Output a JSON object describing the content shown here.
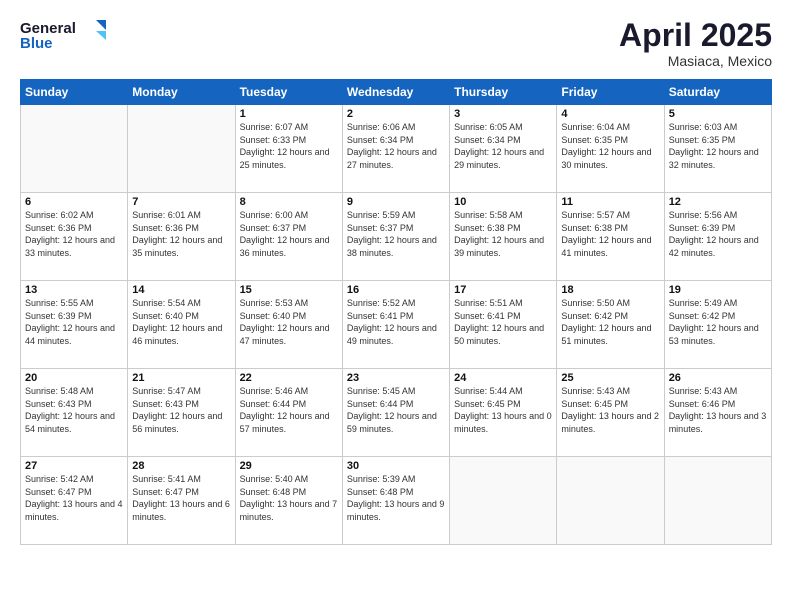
{
  "header": {
    "logo_line1": "General",
    "logo_line2": "Blue",
    "month": "April 2025",
    "location": "Masiaca, Mexico"
  },
  "days_of_week": [
    "Sunday",
    "Monday",
    "Tuesday",
    "Wednesday",
    "Thursday",
    "Friday",
    "Saturday"
  ],
  "weeks": [
    [
      {
        "day": "",
        "sunrise": "",
        "sunset": "",
        "daylight": ""
      },
      {
        "day": "",
        "sunrise": "",
        "sunset": "",
        "daylight": ""
      },
      {
        "day": "1",
        "sunrise": "Sunrise: 6:07 AM",
        "sunset": "Sunset: 6:33 PM",
        "daylight": "Daylight: 12 hours and 25 minutes."
      },
      {
        "day": "2",
        "sunrise": "Sunrise: 6:06 AM",
        "sunset": "Sunset: 6:34 PM",
        "daylight": "Daylight: 12 hours and 27 minutes."
      },
      {
        "day": "3",
        "sunrise": "Sunrise: 6:05 AM",
        "sunset": "Sunset: 6:34 PM",
        "daylight": "Daylight: 12 hours and 29 minutes."
      },
      {
        "day": "4",
        "sunrise": "Sunrise: 6:04 AM",
        "sunset": "Sunset: 6:35 PM",
        "daylight": "Daylight: 12 hours and 30 minutes."
      },
      {
        "day": "5",
        "sunrise": "Sunrise: 6:03 AM",
        "sunset": "Sunset: 6:35 PM",
        "daylight": "Daylight: 12 hours and 32 minutes."
      }
    ],
    [
      {
        "day": "6",
        "sunrise": "Sunrise: 6:02 AM",
        "sunset": "Sunset: 6:36 PM",
        "daylight": "Daylight: 12 hours and 33 minutes."
      },
      {
        "day": "7",
        "sunrise": "Sunrise: 6:01 AM",
        "sunset": "Sunset: 6:36 PM",
        "daylight": "Daylight: 12 hours and 35 minutes."
      },
      {
        "day": "8",
        "sunrise": "Sunrise: 6:00 AM",
        "sunset": "Sunset: 6:37 PM",
        "daylight": "Daylight: 12 hours and 36 minutes."
      },
      {
        "day": "9",
        "sunrise": "Sunrise: 5:59 AM",
        "sunset": "Sunset: 6:37 PM",
        "daylight": "Daylight: 12 hours and 38 minutes."
      },
      {
        "day": "10",
        "sunrise": "Sunrise: 5:58 AM",
        "sunset": "Sunset: 6:38 PM",
        "daylight": "Daylight: 12 hours and 39 minutes."
      },
      {
        "day": "11",
        "sunrise": "Sunrise: 5:57 AM",
        "sunset": "Sunset: 6:38 PM",
        "daylight": "Daylight: 12 hours and 41 minutes."
      },
      {
        "day": "12",
        "sunrise": "Sunrise: 5:56 AM",
        "sunset": "Sunset: 6:39 PM",
        "daylight": "Daylight: 12 hours and 42 minutes."
      }
    ],
    [
      {
        "day": "13",
        "sunrise": "Sunrise: 5:55 AM",
        "sunset": "Sunset: 6:39 PM",
        "daylight": "Daylight: 12 hours and 44 minutes."
      },
      {
        "day": "14",
        "sunrise": "Sunrise: 5:54 AM",
        "sunset": "Sunset: 6:40 PM",
        "daylight": "Daylight: 12 hours and 46 minutes."
      },
      {
        "day": "15",
        "sunrise": "Sunrise: 5:53 AM",
        "sunset": "Sunset: 6:40 PM",
        "daylight": "Daylight: 12 hours and 47 minutes."
      },
      {
        "day": "16",
        "sunrise": "Sunrise: 5:52 AM",
        "sunset": "Sunset: 6:41 PM",
        "daylight": "Daylight: 12 hours and 49 minutes."
      },
      {
        "day": "17",
        "sunrise": "Sunrise: 5:51 AM",
        "sunset": "Sunset: 6:41 PM",
        "daylight": "Daylight: 12 hours and 50 minutes."
      },
      {
        "day": "18",
        "sunrise": "Sunrise: 5:50 AM",
        "sunset": "Sunset: 6:42 PM",
        "daylight": "Daylight: 12 hours and 51 minutes."
      },
      {
        "day": "19",
        "sunrise": "Sunrise: 5:49 AM",
        "sunset": "Sunset: 6:42 PM",
        "daylight": "Daylight: 12 hours and 53 minutes."
      }
    ],
    [
      {
        "day": "20",
        "sunrise": "Sunrise: 5:48 AM",
        "sunset": "Sunset: 6:43 PM",
        "daylight": "Daylight: 12 hours and 54 minutes."
      },
      {
        "day": "21",
        "sunrise": "Sunrise: 5:47 AM",
        "sunset": "Sunset: 6:43 PM",
        "daylight": "Daylight: 12 hours and 56 minutes."
      },
      {
        "day": "22",
        "sunrise": "Sunrise: 5:46 AM",
        "sunset": "Sunset: 6:44 PM",
        "daylight": "Daylight: 12 hours and 57 minutes."
      },
      {
        "day": "23",
        "sunrise": "Sunrise: 5:45 AM",
        "sunset": "Sunset: 6:44 PM",
        "daylight": "Daylight: 12 hours and 59 minutes."
      },
      {
        "day": "24",
        "sunrise": "Sunrise: 5:44 AM",
        "sunset": "Sunset: 6:45 PM",
        "daylight": "Daylight: 13 hours and 0 minutes."
      },
      {
        "day": "25",
        "sunrise": "Sunrise: 5:43 AM",
        "sunset": "Sunset: 6:45 PM",
        "daylight": "Daylight: 13 hours and 2 minutes."
      },
      {
        "day": "26",
        "sunrise": "Sunrise: 5:43 AM",
        "sunset": "Sunset: 6:46 PM",
        "daylight": "Daylight: 13 hours and 3 minutes."
      }
    ],
    [
      {
        "day": "27",
        "sunrise": "Sunrise: 5:42 AM",
        "sunset": "Sunset: 6:47 PM",
        "daylight": "Daylight: 13 hours and 4 minutes."
      },
      {
        "day": "28",
        "sunrise": "Sunrise: 5:41 AM",
        "sunset": "Sunset: 6:47 PM",
        "daylight": "Daylight: 13 hours and 6 minutes."
      },
      {
        "day": "29",
        "sunrise": "Sunrise: 5:40 AM",
        "sunset": "Sunset: 6:48 PM",
        "daylight": "Daylight: 13 hours and 7 minutes."
      },
      {
        "day": "30",
        "sunrise": "Sunrise: 5:39 AM",
        "sunset": "Sunset: 6:48 PM",
        "daylight": "Daylight: 13 hours and 9 minutes."
      },
      {
        "day": "",
        "sunrise": "",
        "sunset": "",
        "daylight": ""
      },
      {
        "day": "",
        "sunrise": "",
        "sunset": "",
        "daylight": ""
      },
      {
        "day": "",
        "sunrise": "",
        "sunset": "",
        "daylight": ""
      }
    ]
  ]
}
